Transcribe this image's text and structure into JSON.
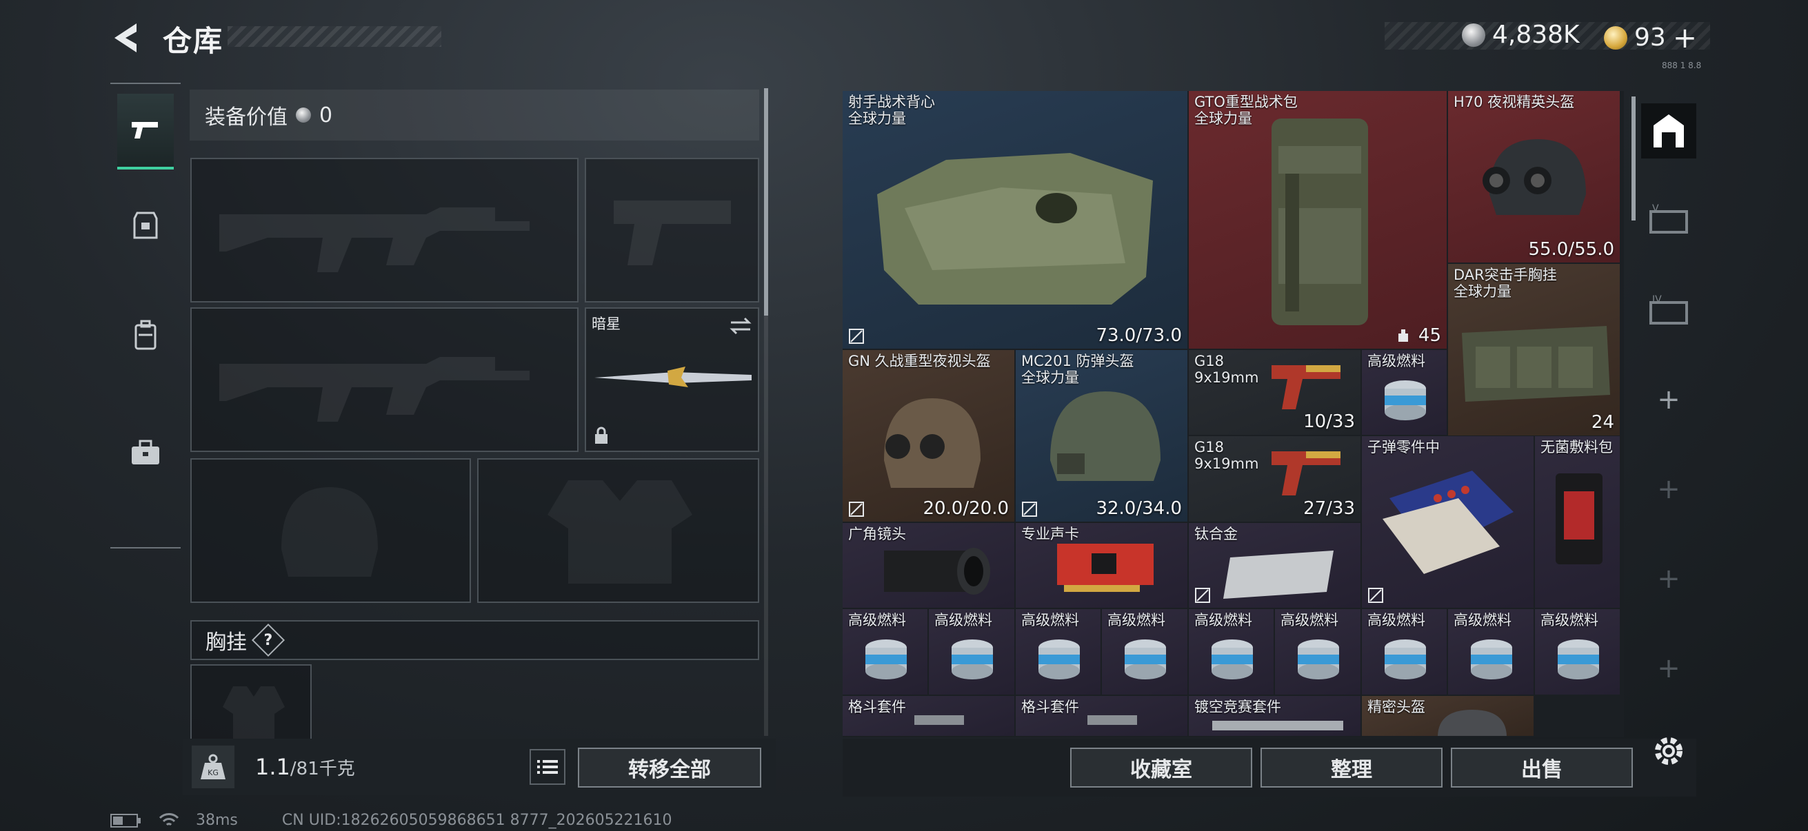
{
  "header": {
    "title": "仓库",
    "currency_silver": "4,838K",
    "currency_gold": "93",
    "currency_add": "+",
    "tiny_text": "888 1 8.8"
  },
  "loadout": {
    "equip_value_label": "装备价值",
    "equip_value": "0",
    "melee_name": "暗星",
    "chest_label": "胸挂",
    "chest_help": "?",
    "weight_value": "1.1",
    "weight_max": "/81千克",
    "weight_icon_text": "KG",
    "transfer_all": "转移全部"
  },
  "stash": {
    "items": [
      {
        "name": "射手战术背心\n全球力量",
        "value": "73.0/73.0"
      },
      {
        "name": "GTO重型战术包\n全球力量",
        "value": "45"
      },
      {
        "name": "H70 夜视精英头盔",
        "value": "55.0/55.0"
      },
      {
        "name": "DAR突击手胸挂\n全球力量",
        "value": "24"
      },
      {
        "name": "GN 久战重型夜视头盔",
        "value": "20.0/20.0"
      },
      {
        "name": "MC201 防弹头盔\n全球力量",
        "value": "32.0/34.0"
      },
      {
        "name": "G18\n9x19mm",
        "value": "10/33"
      },
      {
        "name": "高级燃料",
        "value": ""
      },
      {
        "name": "G18\n9x19mm",
        "value": "27/33"
      },
      {
        "name": "子弹零件中",
        "value": ""
      },
      {
        "name": "无菌敷料包",
        "value": ""
      },
      {
        "name": "广角镜头",
        "value": ""
      },
      {
        "name": "专业声卡",
        "value": ""
      },
      {
        "name": "钛合金",
        "value": ""
      },
      {
        "name": "高级燃料",
        "value": ""
      },
      {
        "name": "高级燃料",
        "value": ""
      },
      {
        "name": "高级燃料",
        "value": ""
      },
      {
        "name": "高级燃料",
        "value": ""
      },
      {
        "name": "高级燃料",
        "value": ""
      },
      {
        "name": "高级燃料",
        "value": ""
      },
      {
        "name": "高级燃料",
        "value": ""
      },
      {
        "name": "高级燃料",
        "value": ""
      },
      {
        "name": "高级燃料",
        "value": ""
      },
      {
        "name": "格斗套件",
        "value": ""
      },
      {
        "name": "格斗套件",
        "value": ""
      },
      {
        "name": "镀空竞赛套件",
        "value": ""
      },
      {
        "name": "精密头盔",
        "value": ""
      }
    ]
  },
  "side_tabs": {
    "tab2": "V",
    "tab3": "IV",
    "add": "+"
  },
  "actions": {
    "collection": "收藏室",
    "sort": "整理",
    "sell": "出售"
  },
  "status_bar": {
    "ping": "38ms",
    "uid": "CN UID:18262605059868651 8777_202605221610"
  },
  "colors": {
    "accent_green": "#3fd0a0",
    "rarity_red": "#6a2a2e",
    "rarity_blue": "#283c52",
    "rarity_purple": "#302b3d",
    "rarity_brown": "#4a3a30"
  }
}
